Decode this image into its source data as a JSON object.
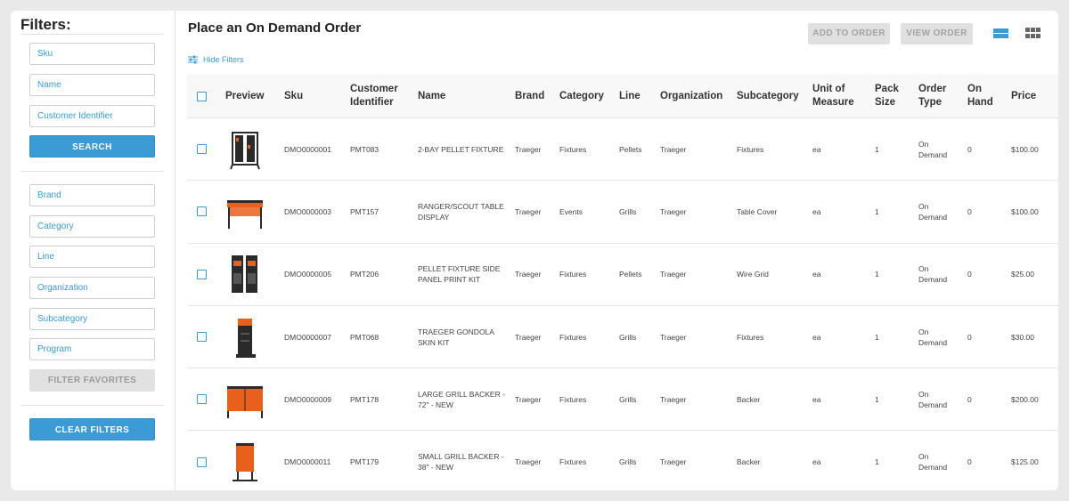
{
  "sidebar": {
    "title": "Filters:",
    "search_fields": [
      {
        "placeholder": "Sku"
      },
      {
        "placeholder": "Name"
      },
      {
        "placeholder": "Customer Identifier"
      }
    ],
    "search_label": "SEARCH",
    "facets": [
      "Brand",
      "Category",
      "Line",
      "Organization",
      "Subcategory",
      "Program"
    ],
    "favorites_label": "FILTER FAVORITES",
    "clear_label": "CLEAR FILTERS"
  },
  "main": {
    "title": "Place an On Demand Order",
    "add_to_order": "ADD TO ORDER",
    "view_order": "VIEW ORDER",
    "hide_filters": "Hide Filters"
  },
  "colors": {
    "accent": "#3a9bd5",
    "product": "#e8601c",
    "dark": "#2a2a2a"
  },
  "table": {
    "headers": {
      "preview": "Preview",
      "sku": "Sku",
      "cust_id": "Customer Identifier",
      "name": "Name",
      "brand": "Brand",
      "category": "Category",
      "line": "Line",
      "organization": "Organization",
      "subcategory": "Subcategory",
      "uom": "Unit of Measure",
      "pack": "Pack Size",
      "order_type": "Order Type",
      "on_hand": "On Hand",
      "price": "Price"
    },
    "rows": [
      {
        "thumb": "pellet-rack",
        "sku": "DMO0000001",
        "cust_id": "PMT083",
        "name": "2-BAY PELLET FIXTURE",
        "brand": "Traeger",
        "category": "Fixtures",
        "line": "Pellets",
        "organization": "Traeger",
        "subcategory": "Fixtures",
        "uom": "ea",
        "pack": "1",
        "order_type": "On Demand",
        "on_hand": "0",
        "price": "$100.00"
      },
      {
        "thumb": "table",
        "sku": "DMO0000003",
        "cust_id": "PMT157",
        "name": "RANGER/SCOUT TABLE DISPLAY",
        "brand": "Traeger",
        "category": "Events",
        "line": "Grills",
        "organization": "Traeger",
        "subcategory": "Table Cover",
        "uom": "ea",
        "pack": "1",
        "order_type": "On Demand",
        "on_hand": "0",
        "price": "$100.00"
      },
      {
        "thumb": "panels",
        "sku": "DMO0000005",
        "cust_id": "PMT206",
        "name": "PELLET FIXTURE SIDE PANEL PRINT KIT",
        "brand": "Traeger",
        "category": "Fixtures",
        "line": "Pellets",
        "organization": "Traeger",
        "subcategory": "Wire Grid",
        "uom": "ea",
        "pack": "1",
        "order_type": "On Demand",
        "on_hand": "0",
        "price": "$25.00"
      },
      {
        "thumb": "gondola",
        "sku": "DMO0000007",
        "cust_id": "PMT068",
        "name": "TRAEGER GONDOLA SKIN KIT",
        "brand": "Traeger",
        "category": "Fixtures",
        "line": "Grills",
        "organization": "Traeger",
        "subcategory": "Fixtures",
        "uom": "ea",
        "pack": "1",
        "order_type": "On Demand",
        "on_hand": "0",
        "price": "$30.00"
      },
      {
        "thumb": "backer-large",
        "sku": "DMO0000009",
        "cust_id": "PMT178",
        "name": "LARGE GRILL BACKER - 72\" - NEW",
        "brand": "Traeger",
        "category": "Fixtures",
        "line": "Grills",
        "organization": "Traeger",
        "subcategory": "Backer",
        "uom": "ea",
        "pack": "1",
        "order_type": "On Demand",
        "on_hand": "0",
        "price": "$200.00"
      },
      {
        "thumb": "backer-small",
        "sku": "DMO0000011",
        "cust_id": "PMT179",
        "name": "SMALL GRILL BACKER - 38\" - NEW",
        "brand": "Traeger",
        "category": "Fixtures",
        "line": "Grills",
        "organization": "Traeger",
        "subcategory": "Backer",
        "uom": "ea",
        "pack": "1",
        "order_type": "On Demand",
        "on_hand": "0",
        "price": "$125.00"
      }
    ]
  }
}
